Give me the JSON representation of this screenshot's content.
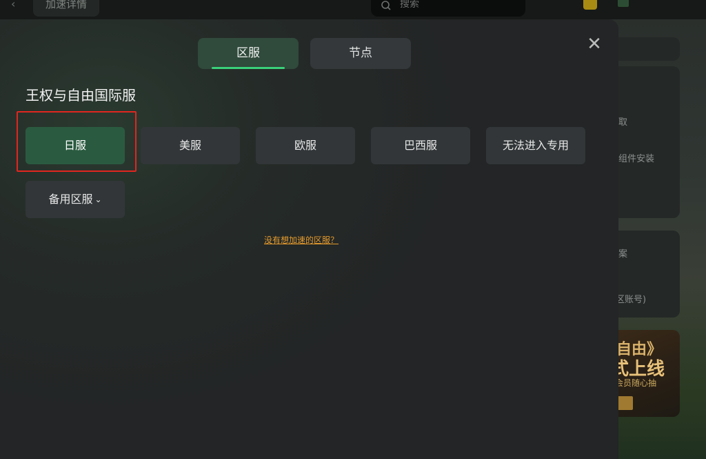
{
  "background": {
    "back_glyph": "‹",
    "header_title": "加速详情",
    "search_placeholder": "搜索",
    "right_panel": {
      "line1": "取",
      "line2": "组件安装",
      "line3": "案",
      "line4": "区账号)",
      "banner_line1": "自由》",
      "banner_line2": "式上线",
      "banner_line3": "会员随心抽"
    }
  },
  "modal": {
    "tabs": [
      {
        "label": "区服",
        "active": true
      },
      {
        "label": "节点",
        "active": false
      }
    ],
    "close_glyph": "✕",
    "game_title": "王权与自由国际服",
    "servers": [
      {
        "label": "日服",
        "selected": true
      },
      {
        "label": "美服",
        "selected": false
      },
      {
        "label": "欧服",
        "selected": false
      },
      {
        "label": "巴西服",
        "selected": false
      },
      {
        "label": "无法进入专用",
        "selected": false
      }
    ],
    "backup_server": {
      "label": "备用区服",
      "chevron": "⌄"
    },
    "help_link": "没有想加速的区服？"
  },
  "colors": {
    "accent_green": "#3ad07a",
    "selected_bg": "#2a5b40",
    "highlight_border": "#e1261f",
    "link_orange": "#e59a2d"
  }
}
